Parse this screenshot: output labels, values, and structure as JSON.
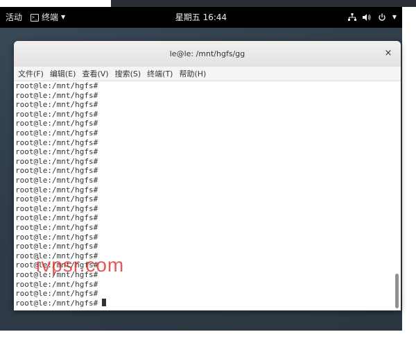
{
  "topbar": {
    "activities": "活动",
    "app_icon_glyph": ">_",
    "app_name": "终端",
    "clock": "星期五 16:44",
    "tray": {
      "network_icon": "network-icon",
      "volume_icon": "volume-icon",
      "power_icon": "power-icon"
    }
  },
  "window": {
    "title": "le@le: /mnt/hgfs/gg",
    "close_glyph": "×",
    "menus": [
      {
        "label": "文件(F)"
      },
      {
        "label": "编辑(E)"
      },
      {
        "label": "查看(V)"
      },
      {
        "label": "搜索(S)"
      },
      {
        "label": "终端(T)"
      },
      {
        "label": "帮助(H)"
      }
    ]
  },
  "terminal": {
    "lines": [
      "root@le:/mnt/hgfs#",
      "root@le:/mnt/hgfs#",
      "root@le:/mnt/hgfs#",
      "root@le:/mnt/hgfs#",
      "root@le:/mnt/hgfs#",
      "root@le:/mnt/hgfs#",
      "root@le:/mnt/hgfs#",
      "root@le:/mnt/hgfs#",
      "root@le:/mnt/hgfs#",
      "root@le:/mnt/hgfs#",
      "root@le:/mnt/hgfs#",
      "root@le:/mnt/hgfs#",
      "root@le:/mnt/hgfs#",
      "root@le:/mnt/hgfs#",
      "root@le:/mnt/hgfs#",
      "root@le:/mnt/hgfs#",
      "root@le:/mnt/hgfs#",
      "root@le:/mnt/hgfs#",
      "root@le:/mnt/hgfs#",
      "root@le:/mnt/hgfs#",
      "root@le:/mnt/hgfs#",
      "root@le:/mnt/hgfs#",
      "root@le:/mnt/hgfs#",
      "root@le:/mnt/hgfs#"
    ]
  },
  "watermark": "ivpsr.com",
  "colors": {
    "topbar_bg": "#000000",
    "terminal_fg": "#2e3436",
    "watermark": "#e11e1e"
  }
}
